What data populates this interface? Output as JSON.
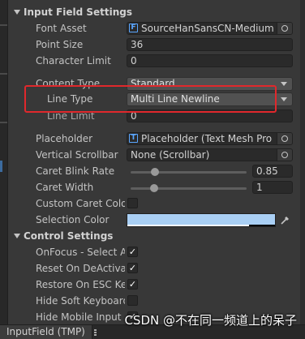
{
  "input_field_settings": {
    "title": "Input Field Settings",
    "font_asset": {
      "label": "Font Asset",
      "value": "SourceHanSansCN-Medium S",
      "icon": "font-asset-icon"
    },
    "point_size": {
      "label": "Point Size",
      "value": "36"
    },
    "character_limit": {
      "label": "Character Limit",
      "value": "0"
    },
    "content_type": {
      "label": "Content Type",
      "value": "Standard"
    },
    "line_type": {
      "label": "Line Type",
      "value": "Multi Line Newline"
    },
    "line_limit": {
      "label": "Line Limit",
      "value": "0"
    },
    "placeholder": {
      "label": "Placeholder",
      "value": "Placeholder (Text Mesh Pro UG",
      "icon": "text-component-icon"
    },
    "vertical_scrollbar": {
      "label": "Vertical Scrollbar",
      "value": "None (Scrollbar)"
    },
    "caret_blink_rate": {
      "label": "Caret Blink Rate",
      "value": "0.85",
      "fraction": 0.21
    },
    "caret_width": {
      "label": "Caret Width",
      "value": "1",
      "fraction": 0.2
    },
    "custom_caret_color": {
      "label": "Custom Caret Color",
      "checked": false
    },
    "selection_color": {
      "label": "Selection Color",
      "color": "#a9cff4"
    }
  },
  "control_settings": {
    "title": "Control Settings",
    "onfocus_select_all": {
      "label": "OnFocus - Select All",
      "checked": true
    },
    "reset_on_deactivation": {
      "label": "Reset On DeActivation",
      "checked": true
    },
    "restore_on_esc_key": {
      "label": "Restore On ESC Key",
      "checked": true
    },
    "hide_soft_keyboard": {
      "label": "Hide Soft Keyboard",
      "checked": false
    },
    "hide_mobile_input": {
      "label": "Hide Mobile Input",
      "checked": true
    }
  },
  "bottom_tab": {
    "label": "InputField (TMP)"
  },
  "watermark": "CSDN @不在同一频道上的呆子",
  "colors": {
    "background": "#383838",
    "highlight": "#e0282c",
    "accent": "#5aa6ff"
  }
}
